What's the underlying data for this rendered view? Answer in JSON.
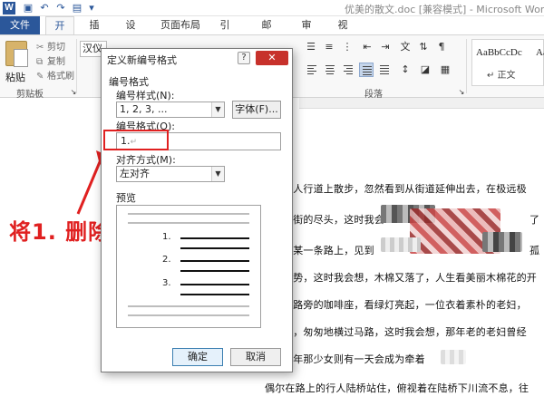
{
  "window": {
    "app_logo": "W",
    "title": "优美的散文.doc [兼容模式] - Microsoft Word"
  },
  "quick_access": [
    {
      "name": "save-icon",
      "glyph": "▣"
    },
    {
      "name": "undo-icon",
      "glyph": "↶"
    },
    {
      "name": "redo-icon",
      "glyph": "↷"
    },
    {
      "name": "doc-icon",
      "glyph": "▤"
    },
    {
      "name": "customize-icon",
      "glyph": "▾"
    }
  ],
  "tabs": {
    "file": "文件",
    "items": [
      "开始",
      "插入",
      "设计",
      "页面布局",
      "引用",
      "邮件",
      "审阅",
      "视图"
    ],
    "active_index": 0
  },
  "ribbon": {
    "paste_label": "粘贴",
    "cut_label": "剪切",
    "copy_label": "复制",
    "format_painter_label": "格式刷",
    "clipboard_group": "剪贴板",
    "font_box_value": "汉仪",
    "paragraph_group": "段落",
    "style_sample": "AaBbCcDc",
    "style_sample2": "Aa",
    "style_name": "↵ 正文"
  },
  "document": {
    "lines": [
      "在人行道上散步，忽然看到从街道延伸出去，在极远极",
      "在街的尽头，这时我会",
      "在某一条路上，见到",
      "姿势，这时我会想，木棉又落了，人生看美丽木棉花的开",
      "在路旁的咖啡座，看绿灯亮起，一位衣着素朴的老妇，",
      "的，匆匆地横过马路，这时我会想，那年老的老妇曾经",
      "当年那少女则有一天会成为牵着",
      "偶尔在路上的行人陆桥站住，俯视着在陆桥下川流不息，往"
    ],
    "frag_2": "了",
    "frag_3": "孤"
  },
  "annotation": {
    "text": "将1. 删除",
    "color": "#e02020"
  },
  "dialog": {
    "title": "定义新编号格式",
    "help": "?",
    "close": "✕",
    "section_number_format": "编号格式",
    "number_style_label": "编号样式(N):",
    "number_style_value": "1, 2, 3, ...",
    "font_button": "字体(F)...",
    "number_format_label": "编号格式(O):",
    "number_format_value": "1.",
    "para_mark": "↵",
    "alignment_label": "对齐方式(M):",
    "alignment_value": "左对齐",
    "preview_label": "预览",
    "preview_numbers": [
      "1.",
      "2.",
      "3."
    ],
    "ok": "确定",
    "cancel": "取消"
  },
  "colors": {
    "accent": "#2b579a",
    "close_red": "#c7312b",
    "annotation_red": "#e02020"
  }
}
